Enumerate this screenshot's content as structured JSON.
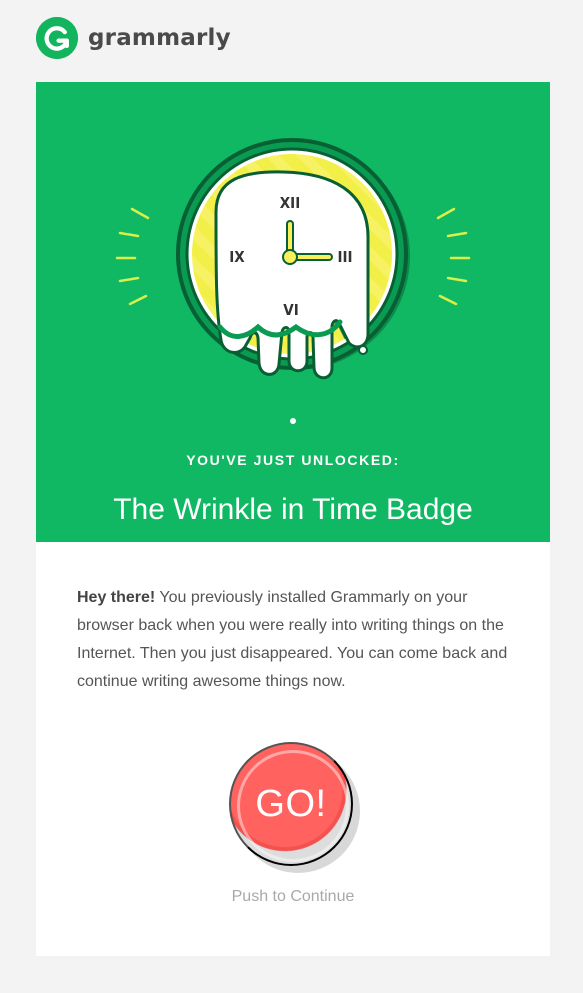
{
  "brand": {
    "name": "grammarly",
    "icon": "grammarly-g-icon",
    "color": "#12b45d"
  },
  "hero": {
    "background_color": "#10b863",
    "illustration": "melting-clock-icon",
    "clock_numerals": {
      "top": "XII",
      "left": "IX",
      "right": "III",
      "bottom": "VI"
    },
    "unlocked_label": "YOU'VE JUST UNLOCKED:",
    "badge_title": "The Wrinkle in Time Badge"
  },
  "message": {
    "greeting": "Hey there!",
    "body": " You previously installed Grammarly on your browser back when you were really into writing things on the Internet. Then you just disappeared. You can come back and continue writing awesome things now."
  },
  "cta": {
    "button_label": "GO!",
    "button_color": "#ff5a58",
    "caption": "Push to Continue"
  }
}
